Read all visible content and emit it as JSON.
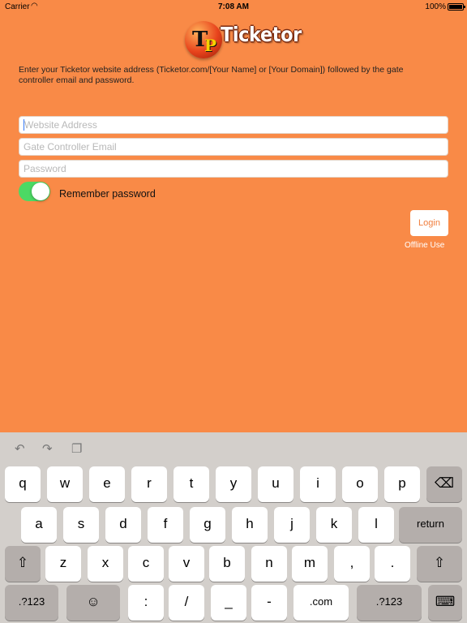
{
  "status": {
    "carrier": "Carrier",
    "wifi_icon": "wifi-icon",
    "time": "7:08 AM",
    "battery": "100%"
  },
  "logo": {
    "text": "Ticketor",
    "badge_t": "T",
    "badge_p": "P"
  },
  "instructions": "Enter your Ticketor website address (Ticketor.com/[Your Name] or [Your Domain]) followed by the gate controller email and password.",
  "form": {
    "website": {
      "value": "",
      "placeholder": "Website Address"
    },
    "email": {
      "value": "",
      "placeholder": "Gate Controller Email"
    },
    "password": {
      "value": "",
      "placeholder": "Password"
    },
    "remember": {
      "label": "Remember password",
      "on": true
    },
    "login_label": "Login",
    "offline_label": "Offline Use"
  },
  "colors": {
    "background": "#f98a47",
    "toggle_on": "#4cd964",
    "login_text": "#f07d3c"
  },
  "keyboard": {
    "toolbar": [
      "undo-icon",
      "redo-icon",
      "paste-icon"
    ],
    "row1": [
      "q",
      "w",
      "e",
      "r",
      "t",
      "y",
      "u",
      "i",
      "o",
      "p"
    ],
    "row2": [
      "a",
      "s",
      "d",
      "f",
      "g",
      "h",
      "j",
      "k",
      "l"
    ],
    "row3": [
      "z",
      "x",
      "c",
      "v",
      "b",
      "n",
      "m",
      ",",
      "."
    ],
    "return_label": "return",
    "numbers_label": ".?123",
    "colon": ":",
    "slash": "/",
    "underscore": "_",
    "dash": "-",
    "dotcom": ".com",
    "shift_glyph": "⇧",
    "delete_glyph": "⌫",
    "emoji_glyph": "☺",
    "hide_glyph": "⌨"
  }
}
